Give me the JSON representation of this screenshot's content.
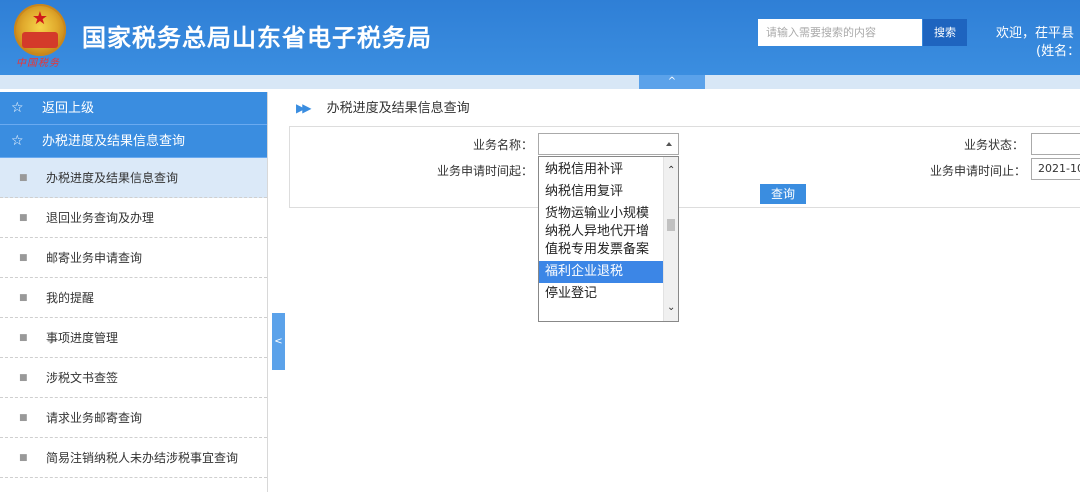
{
  "header": {
    "title": "国家税务总局山东省电子税务局",
    "emblem_caption": "中国税务",
    "search_placeholder": "请输入需要搜索的内容",
    "search_button": "搜索",
    "welcome": "欢迎，茌平县",
    "name_label": "(姓名：",
    "collapse_icon": "chevron-up-icon"
  },
  "sidebar": {
    "top_items": [
      {
        "label": "返回上级",
        "icon": "star-outline-icon"
      },
      {
        "label": "办税进度及结果信息查询",
        "icon": "star-outline-icon"
      }
    ],
    "items": [
      {
        "label": "办税进度及结果信息查询",
        "active": true
      },
      {
        "label": "退回业务查询及办理"
      },
      {
        "label": "邮寄业务申请查询"
      },
      {
        "label": "我的提醒"
      },
      {
        "label": "事项进度管理"
      },
      {
        "label": "涉税文书查签"
      },
      {
        "label": "请求业务邮寄查询"
      },
      {
        "label": "简易注销纳税人未办结涉税事宜查询"
      }
    ]
  },
  "main": {
    "breadcrumb": "办税进度及结果信息查询",
    "form": {
      "business_name_label": "业务名称：",
      "business_status_label": "业务状态：",
      "apply_start_label": "业务申请时间起：",
      "apply_end_label": "业务申请时间止：",
      "apply_end_value": "2021-10-",
      "query_button": "查询"
    },
    "dropdown": {
      "options": [
        {
          "label": "纳税信用补评"
        },
        {
          "label": "纳税信用复评"
        },
        {
          "label": "货物运输业小规模纳税人异地代开增值税专用发票备案"
        },
        {
          "label": "福利企业退税",
          "selected": true
        },
        {
          "label": "停业登记"
        }
      ]
    }
  },
  "colors": {
    "header_blue": "#2f7fd6",
    "accent": "#3a8de0",
    "selected": "#3c86e6"
  }
}
